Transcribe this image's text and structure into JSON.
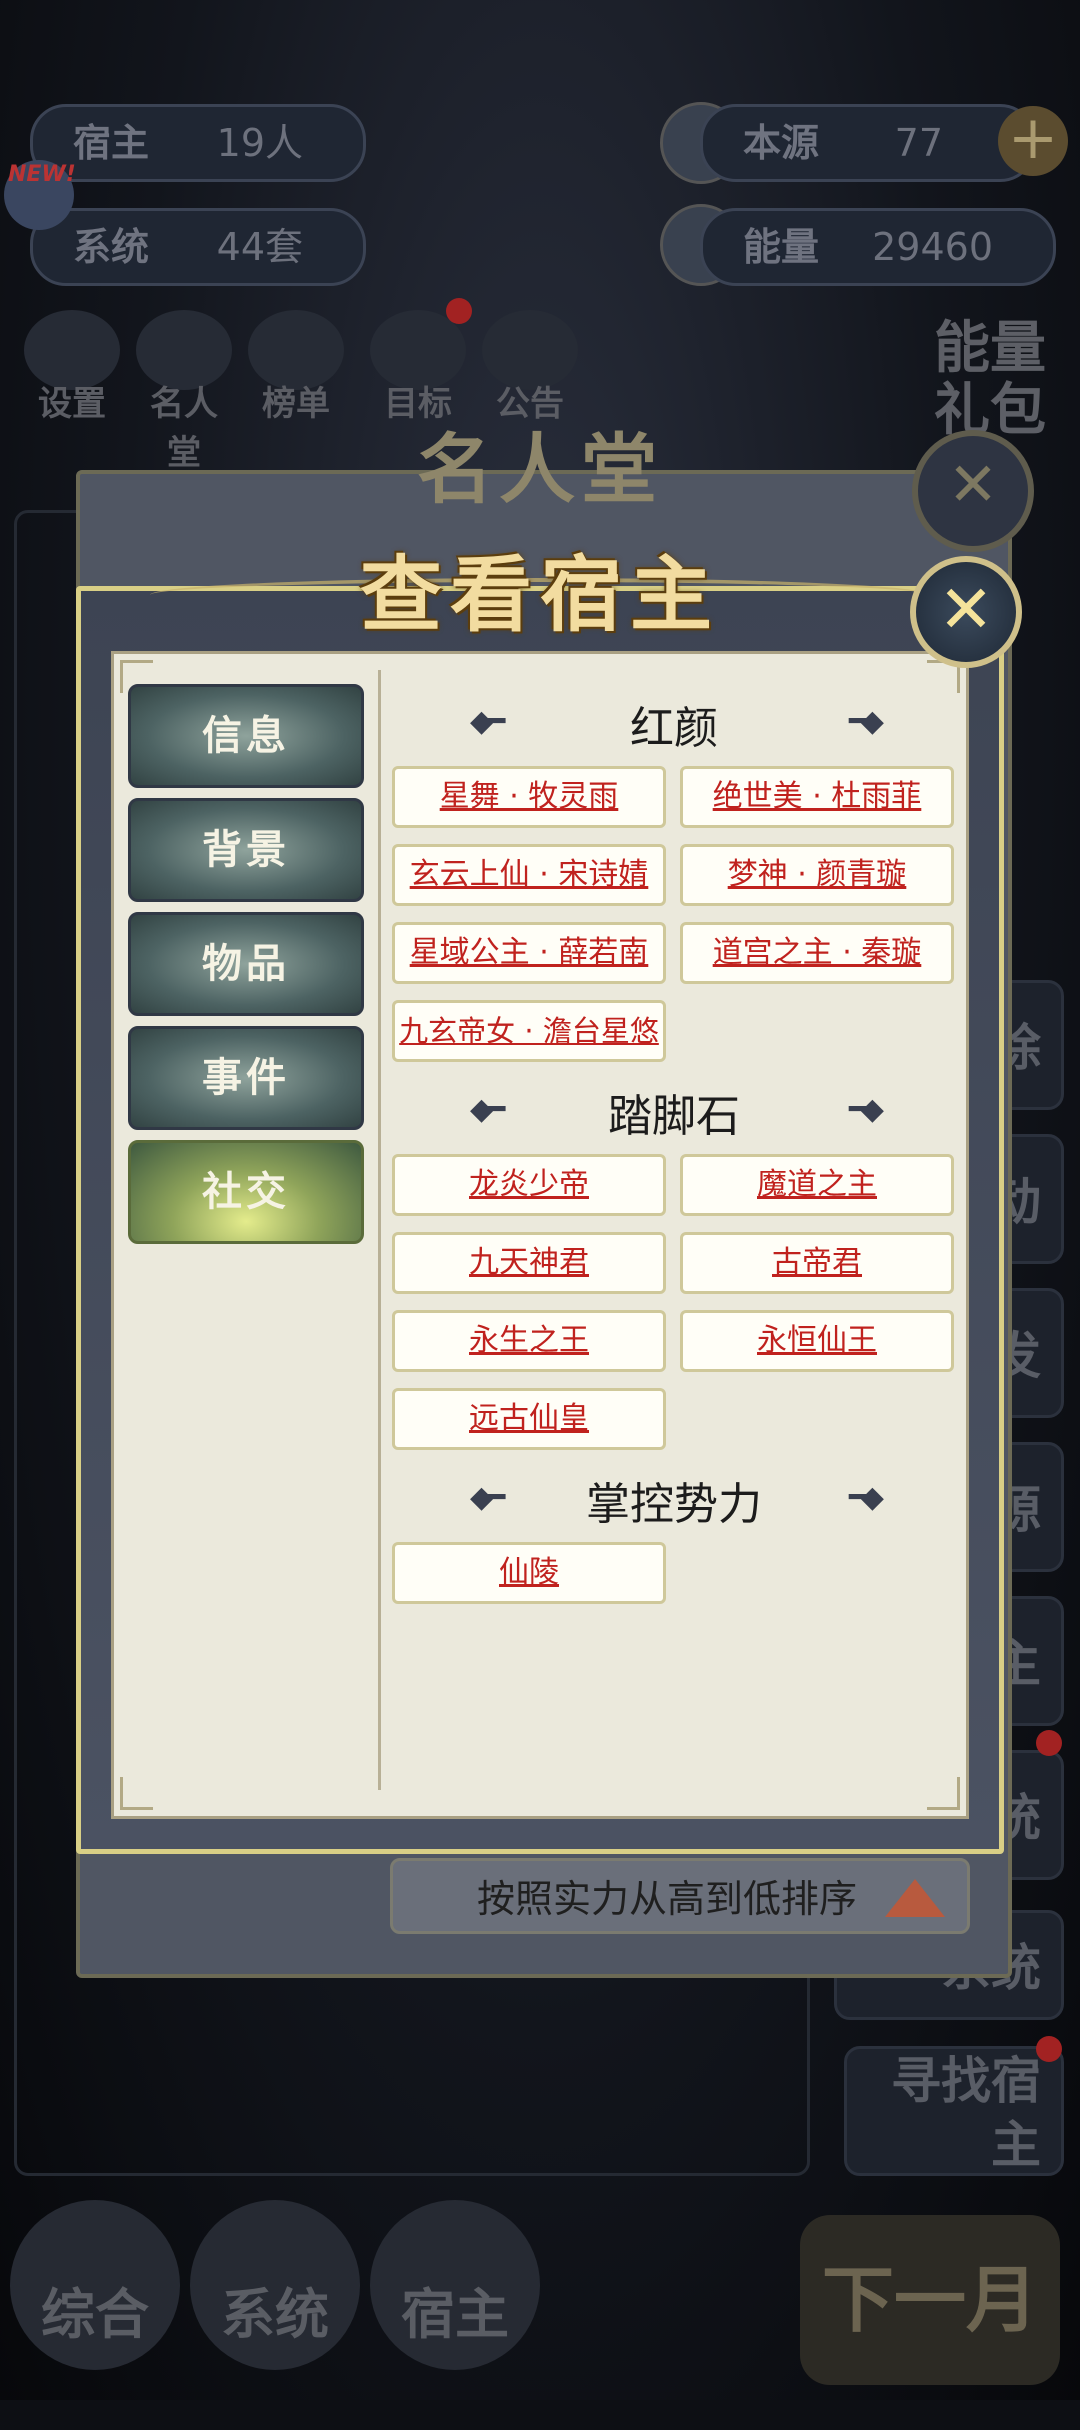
{
  "background": {
    "resources": [
      {
        "label": "宿主",
        "value": "19人"
      },
      {
        "label": "系统",
        "value": "44套"
      },
      {
        "label": "本源",
        "value": "77"
      },
      {
        "label": "能量",
        "value": "29460"
      }
    ],
    "new_badge": "NEW!",
    "top_menu": [
      "设置",
      "名人堂",
      "榜单",
      "目标",
      "公告"
    ],
    "energy_pack": "能量礼包",
    "side_buttons": [
      "除",
      "动",
      "发",
      "源",
      "主",
      "统",
      "系统",
      "寻找宿主"
    ],
    "bottom_nav": [
      "综合",
      "系统",
      "宿主"
    ],
    "next_month": "下一月"
  },
  "back_dialog": {
    "title": "名人堂",
    "sort_label": "按照实力从高到低排序"
  },
  "dialog": {
    "title": "查看宿主",
    "tabs": [
      {
        "label": "信息"
      },
      {
        "label": "背景"
      },
      {
        "label": "物品"
      },
      {
        "label": "事件"
      },
      {
        "label": "社交"
      }
    ],
    "active_tab": "社交",
    "sections": [
      {
        "title": "红颜",
        "entries": [
          "星舞 · 牧灵雨",
          "绝世美 · 杜雨菲",
          "玄云上仙 · 宋诗婧",
          "梦神 · 颜青璇",
          "星域公主 · 薛若南",
          "道宫之主 · 秦璇",
          "九玄帝女 · 澹台星悠"
        ]
      },
      {
        "title": "踏脚石",
        "entries": [
          "龙炎少帝",
          "魔道之主",
          "九天神君",
          "古帝君",
          "永生之王",
          "永恒仙王",
          "远古仙皇"
        ]
      },
      {
        "title": "掌控势力",
        "entries": [
          "仙陵"
        ]
      }
    ]
  },
  "colors": {
    "link_red": "#c0221e",
    "panel_bg": "#ebe9dc",
    "title_gold": "#f2dca0"
  }
}
